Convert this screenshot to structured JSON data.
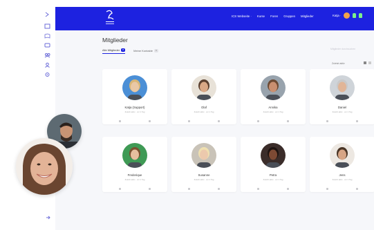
{
  "topbar": {
    "nav": [
      "ICS Webseite ·",
      "Kurse",
      "Foren",
      "Gruppen",
      "Mitglieder"
    ],
    "user_name": "Katja ·"
  },
  "page": {
    "title": "Mitglieder",
    "search_placeholder": "Mitglieder durchsuchen"
  },
  "tabs": [
    {
      "label": "Alle Mitglieder",
      "count": "8"
    },
    {
      "label": "Meine Kontakte",
      "count": "0"
    }
  ],
  "sort_label": "Zuletzt aktiv",
  "members": [
    {
      "name": "Katja (Support)",
      "status": "Zuletzt aktiv · vor 1 Tag",
      "skin": "#e9c8a6",
      "hair": "#d8b677",
      "bg": "#4b8fd6"
    },
    {
      "name": "Olaf",
      "status": "Zuletzt aktiv · vor 1 Tag",
      "skin": "#d9a886",
      "hair": "#5b4030",
      "bg": "#e8e2d8"
    },
    {
      "name": "Annika",
      "status": "Zuletzt aktiv · vor 1 Tag",
      "skin": "#c98f70",
      "hair": "#6c4a33",
      "bg": "#98a3ad"
    },
    {
      "name": "Daniel",
      "status": "Zuletzt aktiv · vor 1 Tag",
      "skin": "#e1b597",
      "hair": "#c9c9c9",
      "bg": "#cfd4d9"
    },
    {
      "name": "Frederique",
      "status": "Zuletzt aktiv · vor 1 Tag",
      "skin": "#e7bf9e",
      "hair": "#7a5230",
      "bg": "#3f9a55"
    },
    {
      "name": "Susanne",
      "status": "Zuletzt aktiv · vor 1 Tag",
      "skin": "#ecc9ad",
      "hair": "#efe0b0",
      "bg": "#c9c3b8"
    },
    {
      "name": "Petra",
      "status": "Zuletzt aktiv · vor 1 Tag",
      "skin": "#7d4a34",
      "hair": "#1e1310",
      "bg": "#3b2d2a"
    },
    {
      "name": "Jens",
      "status": "Zuletzt aktiv · vor 1 Tag",
      "skin": "#d7a585",
      "hair": "#4a3526",
      "bg": "#ede8e2"
    }
  ],
  "colors": {
    "brand": "#1d22e0",
    "background": "#f6f7fa"
  },
  "icons": {
    "rail": [
      "menu-toggle-icon",
      "dashboard-icon",
      "courses-icon",
      "forum-icon",
      "groups-icon",
      "members-icon",
      "settings-icon"
    ],
    "logout": "logout-icon"
  }
}
